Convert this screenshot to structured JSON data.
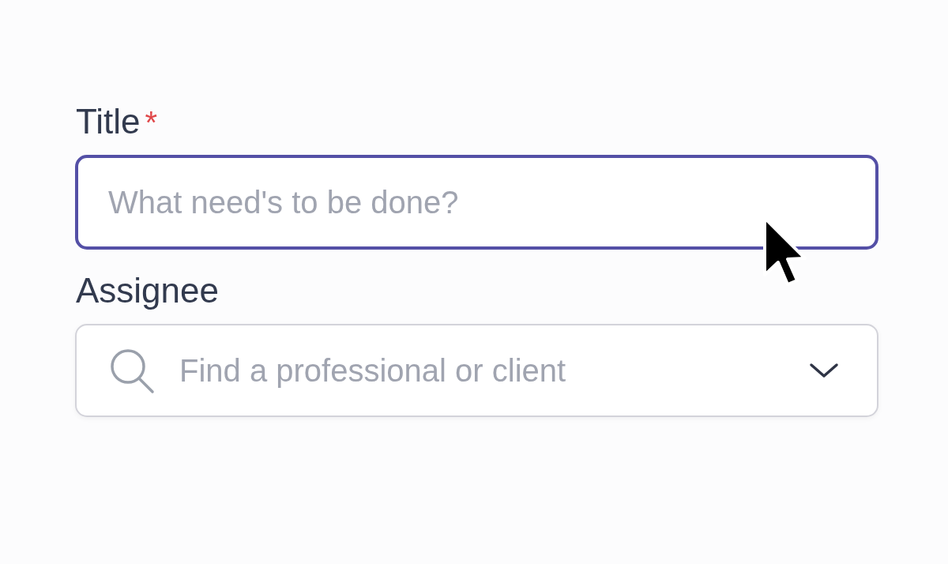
{
  "form": {
    "fields": [
      {
        "kind": "text",
        "label": "Title",
        "required_mark": "*",
        "placeholder": "What need's to be done?",
        "focused": true
      },
      {
        "kind": "search-select",
        "label": "Assignee",
        "placeholder": "Find a professional or client",
        "focused": false
      }
    ]
  }
}
